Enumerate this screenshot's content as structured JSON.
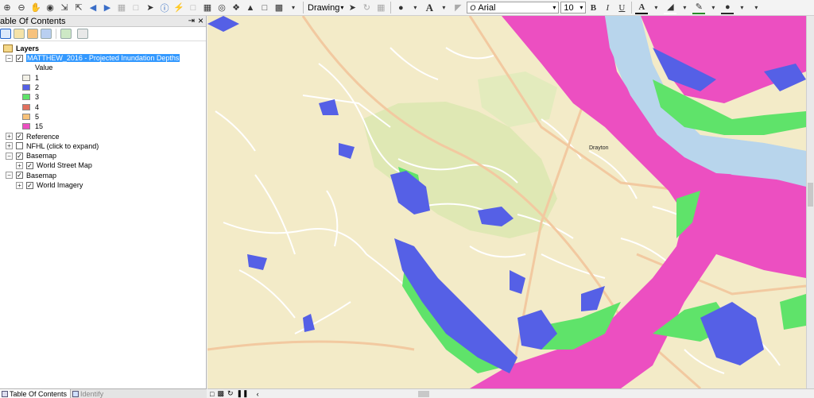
{
  "toolbar": {
    "drawing_label": "Drawing",
    "font_name": "Arial",
    "font_size": "10",
    "bold": "B",
    "italic": "I",
    "underline": "U",
    "font_color_glyph": "A"
  },
  "toc": {
    "title": "able Of Contents",
    "pin_glyph": "⇥",
    "close_glyph": "×",
    "root_label": "Layers",
    "layers": [
      {
        "label": "MATTHEW_2016 - Projected Inundation Depths",
        "expanded": true,
        "checked": true,
        "selected": true
      },
      {
        "label": "Reference",
        "expanded": false,
        "checked": true
      },
      {
        "label": "NFHL (click to expand)",
        "expanded": false,
        "checked": false
      },
      {
        "label": "Basemap",
        "expanded": true,
        "checked": true
      },
      {
        "label": "World Street Map",
        "expanded": false,
        "checked": true
      },
      {
        "label": "Basemap",
        "expanded": true,
        "checked": true
      },
      {
        "label": "World Imagery",
        "expanded": false,
        "checked": true
      }
    ],
    "legend_header": "Value",
    "legend": [
      {
        "label": "1",
        "color": "#f2f0e6"
      },
      {
        "label": "2",
        "color": "#5560e6"
      },
      {
        "label": "3",
        "color": "#5fe36a"
      },
      {
        "label": "4",
        "color": "#e2705e"
      },
      {
        "label": "5",
        "color": "#f7c27a"
      },
      {
        "label": "15",
        "color": "#ec4fc1"
      }
    ]
  },
  "tabs": {
    "toc_tab": "Table Of Contents",
    "identify_tab": "Identify"
  },
  "map": {
    "labels": {
      "drayton": "Drayton"
    },
    "colors": {
      "land": "#f3ebc8",
      "park": "#dfe8b4",
      "water": "#b8d5ec",
      "depth_2": "#5560e6",
      "depth_3": "#5fe36a",
      "depth_15": "#ec4fc1",
      "road": "#ffffff",
      "major_road": "#f2c9a0"
    }
  }
}
